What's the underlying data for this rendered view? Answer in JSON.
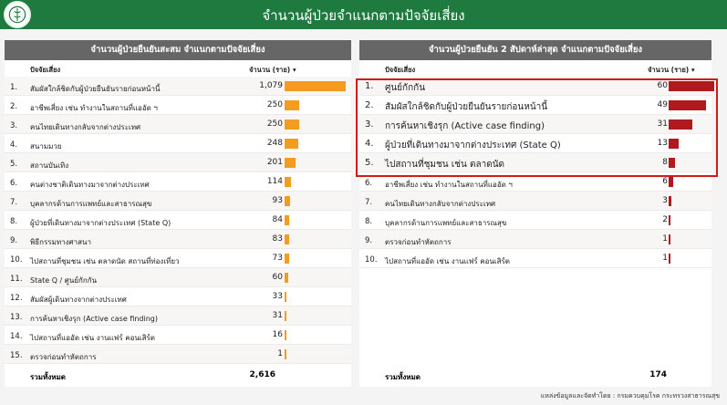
{
  "header": {
    "title": "จำนวนผู้ป่วยจำแนกตามปัจจัยเสี่ยง"
  },
  "footer": {
    "text": "แหล่งข้อมูลและจัดทำโดย : กรมควบคุมโรค กระทรวงสาธารณสุข"
  },
  "colors": {
    "header": "#1f7a3f",
    "left_bar": "#f39c1f",
    "right_bar": "#b0191e",
    "highlight": "#d11a1a"
  },
  "chart_data": [
    {
      "type": "bar",
      "title": "จำนวนผู้ป่วยยืนยันสะสม จำแนกตามปัจจัยเสี่ยง",
      "column_headers": {
        "name": "ปัจจัยเสี่ยง",
        "value": "จำนวน (ราย)",
        "sort": "▾"
      },
      "numbers": [
        "1.",
        "2.",
        "3.",
        "4.",
        "5.",
        "6.",
        "7.",
        "8.",
        "9.",
        "10.",
        "11.",
        "12.",
        "13.",
        "14.",
        "15."
      ],
      "categories": [
        "สัมผัสใกล้ชิดกับผู้ป่วยยืนยันรายก่อนหน้านี้",
        "อาชีพเสี่ยง เช่น ทำงานในสถานที่แออัด ฯ",
        "คนไทยเดินทางกลับจากต่างประเทศ",
        "สนามมวย",
        "สถานบันเทิง",
        "คนต่างชาติเดินทางมาจากต่างประเทศ",
        "บุคลากรด้านการแพทย์และสาธารณสุข",
        "ผู้ป่วยที่เดินทางมาจากต่างประเทศ (State Q)",
        "พิธีกรรมทางศาสนา",
        "ไปสถานที่ชุมชน เช่น ตลาดนัด สถานที่ท่องเที่ยว",
        "State Q / ศูนย์กักกัน",
        "สัมผัสผู้เดินทางจากต่างประเทศ",
        "การค้นหาเชิงรุก (Active case finding)",
        "ไปสถานที่แออัด เช่น งานแฟร์ คอนเสิร์ต",
        "ตรวจก่อนทำหัตถการ"
      ],
      "values": [
        1079,
        250,
        250,
        248,
        201,
        114,
        93,
        84,
        83,
        73,
        60,
        33,
        31,
        16,
        1
      ],
      "values_text": [
        "1,079",
        "250",
        "250",
        "248",
        "201",
        "114",
        "93",
        "84",
        "83",
        "73",
        "60",
        "33",
        "31",
        "16",
        "1"
      ],
      "total_label": "รวมทั้งหมด",
      "total": "2,616"
    },
    {
      "type": "bar",
      "title": "จำนวนผู้ป่วยยืนยัน 2 สัปดาห์ล่าสุด จำแนกตามปัจจัยเสี่ยง",
      "column_headers": {
        "name": "ปัจจัยเสี่ยง",
        "value": "จำนวน (ราย)",
        "sort": "▾"
      },
      "numbers": [
        "1.",
        "2.",
        "3.",
        "4.",
        "5.",
        "6.",
        "7.",
        "8.",
        "9.",
        "10."
      ],
      "categories": [
        "ศูนย์กักกัน",
        "สัมผัสใกล้ชิดกับผู้ป่วยยืนยันรายก่อนหน้านี้",
        "การค้นหาเชิงรุก (Active case finding)",
        "ผู้ป่วยที่เดินทางมาจากต่างประเทศ (State Q)",
        "ไปสถานที่ชุมชน เช่น ตลาดนัด",
        "อาชีพเสี่ยง เช่น ทำงานในสถานที่แออัด ฯ",
        "คนไทยเดินทางกลับจากต่างประเทศ",
        "บุคลากรด้านการแพทย์และสาธารณสุข",
        "ตรวจก่อนทำหัตถการ",
        "ไปสถานที่แออัด เช่น งานแฟร์ คอนเสิร์ต"
      ],
      "values": [
        60,
        49,
        31,
        13,
        8,
        6,
        3,
        2,
        1,
        1
      ],
      "values_text": [
        "60",
        "49",
        "31",
        "13",
        "8",
        "6",
        "3",
        "2",
        "1",
        "1"
      ],
      "highlighted_rows": [
        1,
        2,
        3,
        4,
        5
      ],
      "total_label": "รวมทั้งหมด",
      "total": "174"
    }
  ]
}
